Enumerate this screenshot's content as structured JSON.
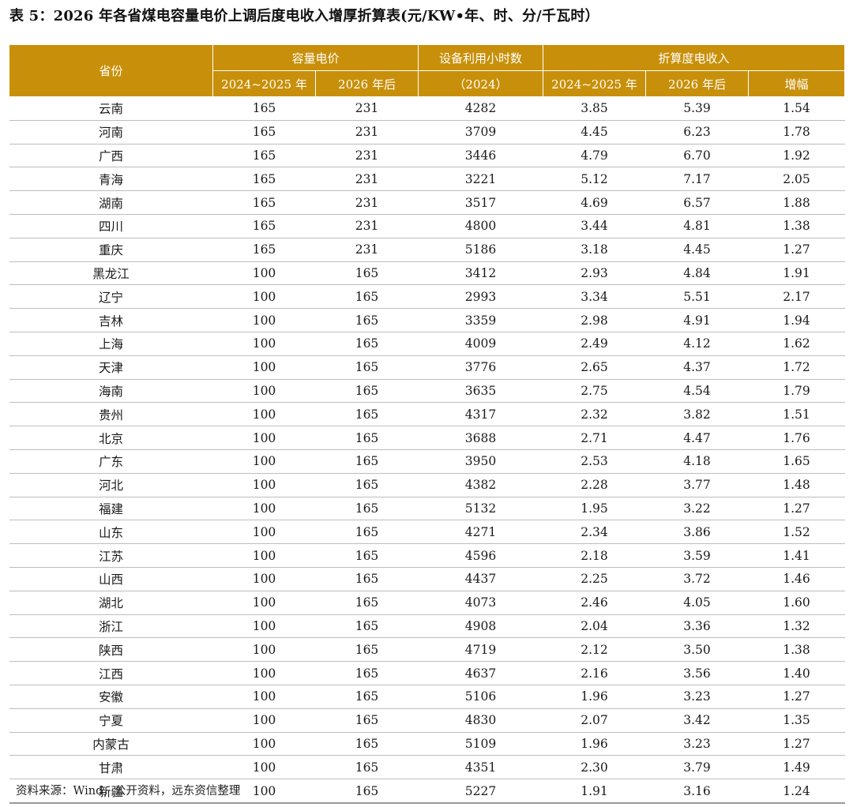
{
  "title": "表 5：2026 年各省煤电容量电价上调后度电收入增厚折算表(元/KW•年、时、分/千瓦时）",
  "header": {
    "province": "省份",
    "capacity_price": "容量电价",
    "utilization_hours": "设备利用小时数",
    "utilization_year": "（2024）",
    "per_kwh_income": "折算度电收入",
    "col_2024_2025": "2024~2025 年",
    "col_2026": "2026 年后",
    "col_increase": "增幅"
  },
  "rows": [
    [
      "云南",
      "165",
      "231",
      "4282",
      "3.85",
      "5.39",
      "1.54"
    ],
    [
      "河南",
      "165",
      "231",
      "3709",
      "4.45",
      "6.23",
      "1.78"
    ],
    [
      "广西",
      "165",
      "231",
      "3446",
      "4.79",
      "6.70",
      "1.92"
    ],
    [
      "青海",
      "165",
      "231",
      "3221",
      "5.12",
      "7.17",
      "2.05"
    ],
    [
      "湖南",
      "165",
      "231",
      "3517",
      "4.69",
      "6.57",
      "1.88"
    ],
    [
      "四川",
      "165",
      "231",
      "4800",
      "3.44",
      "4.81",
      "1.38"
    ],
    [
      "重庆",
      "165",
      "231",
      "5186",
      "3.18",
      "4.45",
      "1.27"
    ],
    [
      "黑龙江",
      "100",
      "165",
      "3412",
      "2.93",
      "4.84",
      "1.91"
    ],
    [
      "辽宁",
      "100",
      "165",
      "2993",
      "3.34",
      "5.51",
      "2.17"
    ],
    [
      "吉林",
      "100",
      "165",
      "3359",
      "2.98",
      "4.91",
      "1.94"
    ],
    [
      "上海",
      "100",
      "165",
      "4009",
      "2.49",
      "4.12",
      "1.62"
    ],
    [
      "天津",
      "100",
      "165",
      "3776",
      "2.65",
      "4.37",
      "1.72"
    ],
    [
      "海南",
      "100",
      "165",
      "3635",
      "2.75",
      "4.54",
      "1.79"
    ],
    [
      "贵州",
      "100",
      "165",
      "4317",
      "2.32",
      "3.82",
      "1.51"
    ],
    [
      "北京",
      "100",
      "165",
      "3688",
      "2.71",
      "4.47",
      "1.76"
    ],
    [
      "广东",
      "100",
      "165",
      "3950",
      "2.53",
      "4.18",
      "1.65"
    ],
    [
      "河北",
      "100",
      "165",
      "4382",
      "2.28",
      "3.77",
      "1.48"
    ],
    [
      "福建",
      "100",
      "165",
      "5132",
      "1.95",
      "3.22",
      "1.27"
    ],
    [
      "山东",
      "100",
      "165",
      "4271",
      "2.34",
      "3.86",
      "1.52"
    ],
    [
      "江苏",
      "100",
      "165",
      "4596",
      "2.18",
      "3.59",
      "1.41"
    ],
    [
      "山西",
      "100",
      "165",
      "4437",
      "2.25",
      "3.72",
      "1.46"
    ],
    [
      "湖北",
      "100",
      "165",
      "4073",
      "2.46",
      "4.05",
      "1.60"
    ],
    [
      "浙江",
      "100",
      "165",
      "4908",
      "2.04",
      "3.36",
      "1.32"
    ],
    [
      "陕西",
      "100",
      "165",
      "4719",
      "2.12",
      "3.50",
      "1.38"
    ],
    [
      "江西",
      "100",
      "165",
      "4637",
      "2.16",
      "3.56",
      "1.40"
    ],
    [
      "安徽",
      "100",
      "165",
      "5106",
      "1.96",
      "3.23",
      "1.27"
    ],
    [
      "宁夏",
      "100",
      "165",
      "4830",
      "2.07",
      "3.42",
      "1.35"
    ],
    [
      "内蒙古",
      "100",
      "165",
      "5109",
      "1.96",
      "3.23",
      "1.27"
    ],
    [
      "甘肃",
      "100",
      "165",
      "4351",
      "2.30",
      "3.79",
      "1.49"
    ],
    [
      "新疆",
      "100",
      "165",
      "5227",
      "1.91",
      "3.16",
      "1.24"
    ]
  ],
  "source": "资料来源：Wind，公开资料，远东资信整理"
}
